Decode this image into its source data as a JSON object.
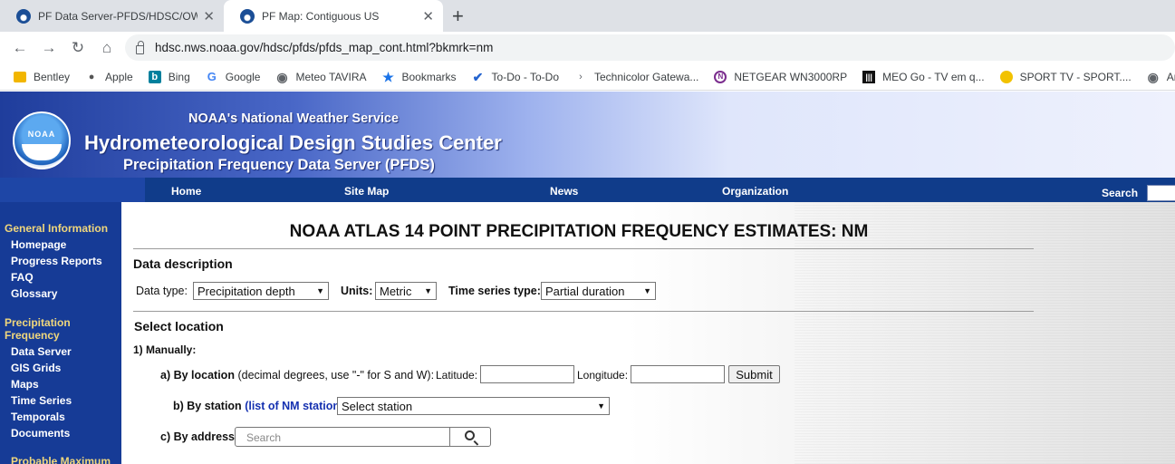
{
  "browser": {
    "tabs": [
      {
        "title": "PF Data Server-PFDS/HDSC/OWP",
        "active": false
      },
      {
        "title": "PF Map: Contiguous US",
        "active": true
      }
    ],
    "close_glyph": "✕",
    "new_tab_glyph": "+",
    "url": "hdsc.nws.noaa.gov/hdsc/pfds/pfds_map_cont.html?bkmrk=nm",
    "bookmarks": [
      {
        "label": "Bentley",
        "icon": "folder-icon",
        "color": "#f2b600"
      },
      {
        "label": "Apple",
        "icon": "apple-icon",
        "color": "#555555"
      },
      {
        "label": "Bing",
        "icon": "bing-icon",
        "color": "#00809d"
      },
      {
        "label": "Google",
        "icon": "google-icon",
        "color": "#4285f4"
      },
      {
        "label": "Meteo TAVIRA",
        "icon": "globe-icon",
        "color": "#5f6368"
      },
      {
        "label": "Bookmarks",
        "icon": "star-icon",
        "color": "#1a73e8"
      },
      {
        "label": "To-Do - To-Do",
        "icon": "check-icon",
        "color": "#2564cf"
      },
      {
        "label": "Technicolor Gatewa...",
        "icon": "chevron-icon",
        "color": "#5f6368"
      },
      {
        "label": "NETGEAR WN3000RP",
        "icon": "netgear-icon",
        "color": "#7b2d8e"
      },
      {
        "label": "MEO Go - TV em q...",
        "icon": "meo-icon",
        "color": "#111111"
      },
      {
        "label": "SPORT TV - SPORT....",
        "icon": "sport-icon",
        "color": "#f2c200"
      },
      {
        "label": "Arc",
        "icon": "globe-icon",
        "color": "#5f6368"
      }
    ]
  },
  "banner": {
    "line1": "NOAA's National Weather Service",
    "line2": "Hydrometeorological Design Studies Center",
    "line3": "Precipitation Frequency Data Server (PFDS)",
    "logo_text": "NOAA"
  },
  "nav": {
    "items": [
      "Home",
      "Site Map",
      "News",
      "Organization"
    ],
    "search_label": "Search"
  },
  "sidebar": {
    "general_heading": "General Information",
    "general_items": [
      "Homepage",
      "Progress Reports",
      "FAQ",
      "Glossary"
    ],
    "pf_heading_1": "Precipitation",
    "pf_heading_2": "Frequency",
    "pf_items": [
      "Data Server",
      "GIS Grids",
      "Maps",
      "Time Series",
      "Temporals",
      "Documents"
    ],
    "pmp_heading": "Probable Maximum"
  },
  "main": {
    "title": "NOAA ATLAS 14 POINT PRECIPITATION FREQUENCY ESTIMATES: NM",
    "data_description": "Data description",
    "data_type_label": "Data type:",
    "data_type_value": "Precipitation depth",
    "units_label": "Units:",
    "units_value": "Metric",
    "series_label": "Time series type:",
    "series_value": "Partial duration",
    "select_location": "Select location",
    "manually": "1) Manually:",
    "by_location": "a) By location",
    "by_location_hint": "(decimal degrees, use \"-\" for S and W):",
    "latitude_label": "Latitude:",
    "longitude_label": "Longitude:",
    "submit_label": "Submit",
    "by_station": "b) By station",
    "station_link": "(list of NM stations)",
    "station_colon": ":",
    "station_value": "Select station",
    "by_address": "c) By address",
    "address_placeholder": "Search"
  }
}
